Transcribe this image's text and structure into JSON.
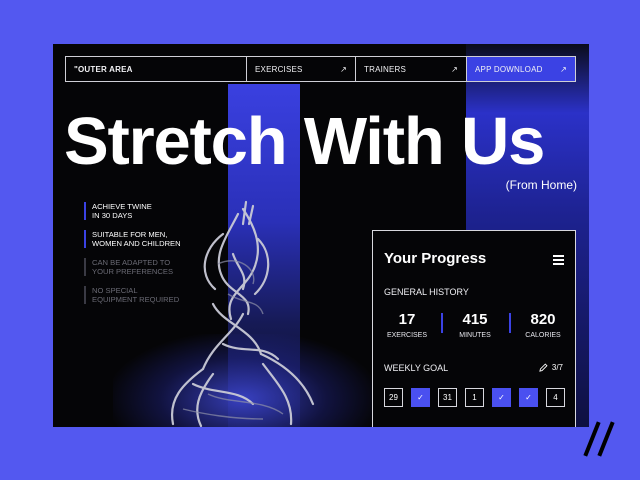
{
  "nav": {
    "brand": "\"OUTER AREA",
    "items": [
      {
        "label": "EXERCISES",
        "icon": "arrow-up-right-icon"
      },
      {
        "label": "TRAINERS",
        "icon": "arrow-up-right-icon"
      },
      {
        "label": "APP DOWNLOAD",
        "icon": "arrow-up-right-icon"
      }
    ]
  },
  "hero": {
    "title": "Stretch With Us",
    "subtitle": "(From Home)"
  },
  "features": [
    {
      "line1": "ACHIEVE TWINE",
      "line2": "IN 30 DAYS",
      "active": true
    },
    {
      "line1": "SUITABLE FOR MEN,",
      "line2": "WOMEN AND CHILDREN",
      "active": true
    },
    {
      "line1": "CAN BE ADAPTED TO",
      "line2": "YOUR PREFERENCES",
      "active": false
    },
    {
      "line1": "NO SPECIAL",
      "line2": "EQUIPMENT REQUIRED",
      "active": false
    }
  ],
  "progress": {
    "title": "Your Progress",
    "history_label": "GENERAL HISTORY",
    "stats": [
      {
        "value": "17",
        "label": "EXERCISES"
      },
      {
        "value": "415",
        "label": "MINUTES"
      },
      {
        "value": "820",
        "label": "CALORIES"
      }
    ],
    "goal_label": "WEEKLY GOAL",
    "goal_count": "3/7",
    "days": [
      {
        "label": "29",
        "done": false
      },
      {
        "label": "✓",
        "done": true
      },
      {
        "label": "31",
        "done": false
      },
      {
        "label": "1",
        "done": false
      },
      {
        "label": "✓",
        "done": true
      },
      {
        "label": "✓",
        "done": true
      },
      {
        "label": "4",
        "done": false
      }
    ]
  },
  "colors": {
    "background": "#5358f0",
    "accent": "#3b42e4",
    "panel": "#050507"
  }
}
